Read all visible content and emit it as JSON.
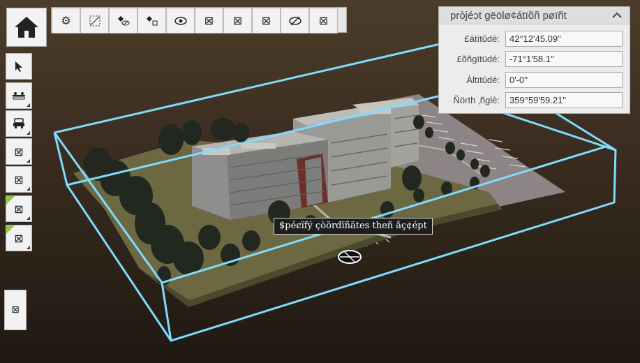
{
  "toolbar": {
    "home_icon": "home-icon",
    "top_tools": [
      "settings-gears-icon",
      "box-select-icon",
      "hide-selection-icon",
      "isolate-icon",
      "eye-icon",
      "placeholder-icon",
      "placeholder-icon",
      "placeholder-icon",
      "eye-hidden-icon",
      "placeholder-icon"
    ],
    "side_tools": [
      "pointer-icon",
      "section-plane-icon",
      "car-icon",
      "placeholder-icon",
      "placeholder-icon",
      "placeholder-icon",
      "placeholder-icon"
    ],
    "extra_tool": "placeholder-icon"
  },
  "geolocation_panel": {
    "title": "pròjéↄt gëölø¢átïõñ pøïñt",
    "fields": [
      {
        "label": "£átïtûdè:",
        "value": "42°12'45.09\""
      },
      {
        "label": "£õñgïtüdé:",
        "value": "-71°1'58.1\""
      },
      {
        "label": "Àltïtûdé:",
        "value": "0'-0\""
      },
      {
        "label": "Ñörth ‚ñglè:",
        "value": "359°59'59.21\""
      }
    ]
  },
  "tooltip": {
    "text": "$péȼïfý çòördïñätes theñ âç¢épt"
  },
  "colors": {
    "background_top": "#4c3c2b",
    "background_bottom": "#1f1912",
    "bounding_box": "#7fdcff",
    "ground": "#6e6b45",
    "parking": "#8f8686",
    "building": "#9a9a98",
    "tree": "#232a20",
    "accent_flag": "#8dc63f"
  }
}
